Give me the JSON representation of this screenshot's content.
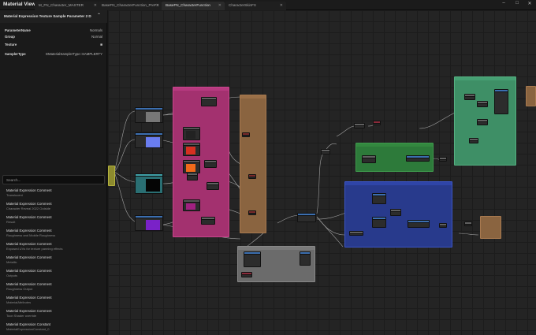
{
  "app": {
    "title": "Material Viewer"
  },
  "tabs": [
    {
      "label": "M_FN_Character_MASTER",
      "active": false
    },
    {
      "label": "BaseFN_CharacterFunction_PreFX",
      "active": false
    },
    {
      "label": "BaseFN_CharacterFunction",
      "active": true
    },
    {
      "label": "CharacterSkinFX",
      "active": false
    }
  ],
  "window_controls": {
    "minimize": "–",
    "maximize": "□",
    "close": "✕"
  },
  "details": {
    "title": "Material Expression Texture Sample Parameter 2 D",
    "rows": [
      {
        "name": "ParameterName",
        "value": "Normals"
      },
      {
        "name": "Group",
        "value": "Normal"
      },
      {
        "name": "Texture",
        "value": ""
      },
      {
        "name": "SamplerType",
        "value": "EMaterialSamplerType::SAMPLERTY"
      }
    ]
  },
  "search": {
    "placeholder": "Search..."
  },
  "expression_list": [
    {
      "title": "Material Expression Comment",
      "subtitle": "Translucent"
    },
    {
      "title": "Material Expression Comment",
      "subtitle": "Character Reveal 2022 Outside"
    },
    {
      "title": "Material Expression Comment",
      "subtitle": "Result"
    },
    {
      "title": "Material Expression Comment",
      "subtitle": "Roughness and Mobile Roughness"
    },
    {
      "title": "Material Expression Comment",
      "subtitle": "Exposed UVs for texture panning effects"
    },
    {
      "title": "Material Expression Comment",
      "subtitle": "Metallic"
    },
    {
      "title": "Material Expression Comment",
      "subtitle": "Outputs"
    },
    {
      "title": "Material Expression Comment",
      "subtitle": "Roughness Output"
    },
    {
      "title": "Material Expression Comment",
      "subtitle": "MaterialAttributes"
    },
    {
      "title": "Material Expression Comment",
      "subtitle": "Toon Shader override"
    },
    {
      "title": "Material Expression Constant",
      "subtitle": "MaterialExpressionConstant_0"
    }
  ],
  "colors": {
    "accent_blue": "#2d6fd6",
    "comment_magenta": "#a3316f",
    "comment_brown": "#8a6440",
    "comment_green": "#2d7a3a",
    "comment_navy": "#283a8c",
    "comment_teal_green": "#3e8f66",
    "comment_gray": "#6b6b6b",
    "comment_olive": "#8c8a2e"
  }
}
